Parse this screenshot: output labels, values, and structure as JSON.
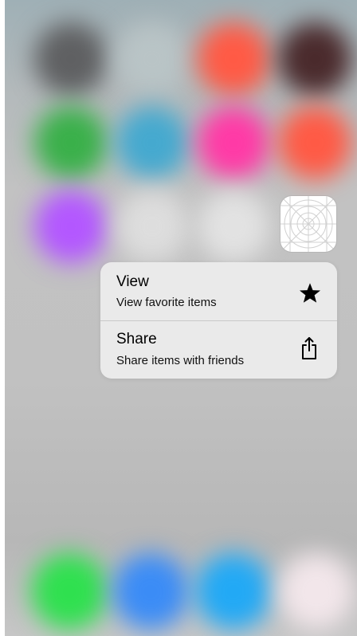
{
  "colors": {
    "menu_background": "#ECECEC",
    "divider": "#C9C9C9",
    "text_primary": "#000000"
  },
  "home_screen": {
    "blurred_icons": [
      {
        "name": "app-row1-col1",
        "color": "#5f6062"
      },
      {
        "name": "app-row1-col2",
        "color": "#b9c4c6"
      },
      {
        "name": "app-row1-col3",
        "color": "#ff5a45"
      },
      {
        "name": "app-row1-col4",
        "color": "#4a2a2c"
      },
      {
        "name": "app-row2-col1",
        "color": "#3ab04a"
      },
      {
        "name": "app-row2-col2",
        "color": "#45a9cf"
      },
      {
        "name": "app-row2-col3",
        "color": "#ff3aa6"
      },
      {
        "name": "app-row2-col4",
        "color": "#ff5a45"
      },
      {
        "name": "app-row3-col1",
        "color": "#b357ff"
      },
      {
        "name": "app-row3-col2",
        "color": "#dddddd"
      },
      {
        "name": "app-row3-col3",
        "color": "#e2e2e2"
      }
    ],
    "dock_icons": [
      {
        "name": "dock-phone",
        "color": "#2fe04f"
      },
      {
        "name": "dock-mail",
        "color": "#3b8cf6"
      },
      {
        "name": "dock-safari",
        "color": "#22a9f5"
      },
      {
        "name": "dock-music",
        "color": "#f2e6ea"
      }
    ],
    "pressed_app_icon": "app-icon-template"
  },
  "quick_actions": {
    "items": [
      {
        "title": "View",
        "subtitle": "View favorite items",
        "icon": "star-icon"
      },
      {
        "title": "Share",
        "subtitle": "Share items with friends",
        "icon": "share-icon"
      }
    ]
  }
}
